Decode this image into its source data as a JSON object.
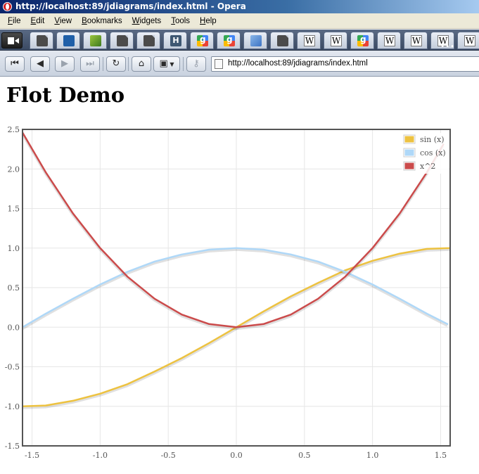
{
  "window": {
    "title": "http://localhost:89/jdiagrams/index.html - Opera"
  },
  "menu": [
    {
      "acc": "F",
      "rest": "ile"
    },
    {
      "acc": "E",
      "rest": "dit"
    },
    {
      "acc": "V",
      "rest": "iew"
    },
    {
      "acc": "B",
      "rest": "ookmarks"
    },
    {
      "acc": "W",
      "rest": "idgets"
    },
    {
      "acc": "T",
      "rest": "ools"
    },
    {
      "acc": "H",
      "rest": "elp"
    }
  ],
  "tabs": [
    {
      "icon": "page-icon"
    },
    {
      "icon": "blue-swirl-icon"
    },
    {
      "icon": "green-grass-icon"
    },
    {
      "icon": "page-icon"
    },
    {
      "icon": "page-icon"
    },
    {
      "icon": "h-icon"
    },
    {
      "icon": "google-icon"
    },
    {
      "icon": "google-icon"
    },
    {
      "icon": "cube-icon"
    },
    {
      "icon": "page-icon"
    },
    {
      "icon": "wikipedia-icon"
    },
    {
      "icon": "wikipedia-icon"
    },
    {
      "icon": "google-icon"
    },
    {
      "icon": "wikipedia-icon"
    },
    {
      "icon": "wikipedia-icon"
    },
    {
      "icon": "wikipedia-icon"
    },
    {
      "icon": "wikipedia-icon"
    }
  ],
  "address_bar": {
    "url": "http://localhost:89/jdiagrams/index.html"
  },
  "page": {
    "heading": "Flot Demo"
  },
  "colors": {
    "sin": "#edc240",
    "cos": "#afd8f8",
    "square": "#cb4b4b",
    "grid": "#e6e6e6",
    "border": "#545454"
  },
  "chart_data": {
    "type": "line",
    "title": "",
    "xlabel": "",
    "ylabel": "",
    "xlim": [
      -1.57,
      1.57
    ],
    "ylim": [
      -1.5,
      2.5
    ],
    "x_ticks": [
      "-1.5",
      "-1.0",
      "-0.5",
      "0.0",
      "0.5",
      "1.0",
      "1.5"
    ],
    "y_ticks": [
      "2.5",
      "2.0",
      "1.5",
      "1.0",
      "0.5",
      "0.0",
      "-0.5",
      "-1.0",
      "-1.5"
    ],
    "grid": true,
    "legend_position": "top-right",
    "series": [
      {
        "name": "sin (x)",
        "color": "#edc240",
        "x": [
          -1.57,
          -1.4,
          -1.2,
          -1.0,
          -0.8,
          -0.6,
          -0.4,
          -0.2,
          0.0,
          0.2,
          0.4,
          0.6,
          0.8,
          1.0,
          1.2,
          1.4,
          1.57
        ],
        "y": [
          -1.0,
          -0.99,
          -0.93,
          -0.84,
          -0.72,
          -0.56,
          -0.39,
          -0.2,
          0.0,
          0.2,
          0.39,
          0.56,
          0.72,
          0.84,
          0.93,
          0.99,
          1.0
        ]
      },
      {
        "name": "cos (x)",
        "color": "#afd8f8",
        "x": [
          -1.57,
          -1.4,
          -1.2,
          -1.0,
          -0.8,
          -0.6,
          -0.4,
          -0.2,
          0.0,
          0.2,
          0.4,
          0.6,
          0.8,
          1.0,
          1.2,
          1.4,
          1.55
        ],
        "y": [
          0.0,
          0.17,
          0.36,
          0.54,
          0.7,
          0.83,
          0.92,
          0.98,
          1.0,
          0.98,
          0.92,
          0.83,
          0.7,
          0.54,
          0.36,
          0.17,
          0.04
        ]
      },
      {
        "name": "x^2",
        "color": "#cb4b4b",
        "x": [
          -1.57,
          -1.4,
          -1.2,
          -1.0,
          -0.8,
          -0.6,
          -0.4,
          -0.2,
          0.0,
          0.2,
          0.4,
          0.6,
          0.8,
          1.0,
          1.2,
          1.4,
          1.52
        ],
        "y": [
          2.46,
          1.96,
          1.44,
          1.0,
          0.64,
          0.36,
          0.16,
          0.04,
          0.0,
          0.04,
          0.16,
          0.36,
          0.64,
          1.0,
          1.44,
          1.96,
          2.31
        ]
      }
    ]
  }
}
